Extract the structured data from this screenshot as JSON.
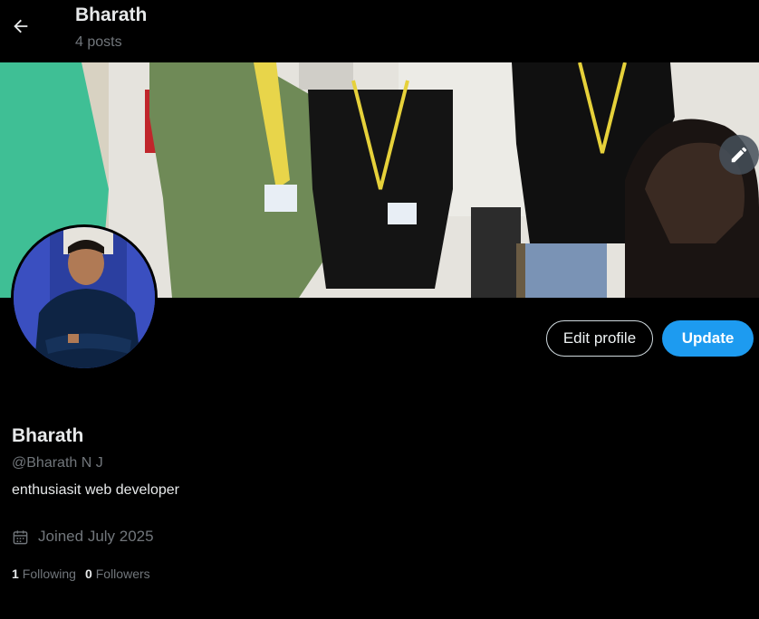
{
  "header": {
    "name": "Bharath",
    "posts": "4 posts"
  },
  "profile": {
    "display_name": "Bharath",
    "handle": "@Bharath N J",
    "bio": "enthusiasit web developer",
    "joined": "Joined July 2025",
    "following_count": "1",
    "following_label": "Following",
    "followers_count": "0",
    "followers_label": "Followers"
  },
  "buttons": {
    "edit_profile": "Edit profile",
    "update": "Update"
  },
  "icons": {
    "back": "arrow-left-icon",
    "edit_banner": "pencil-icon",
    "calendar": "calendar-icon"
  },
  "colors": {
    "accent": "#1d9bf0",
    "background": "#000000",
    "muted": "#71767b"
  }
}
